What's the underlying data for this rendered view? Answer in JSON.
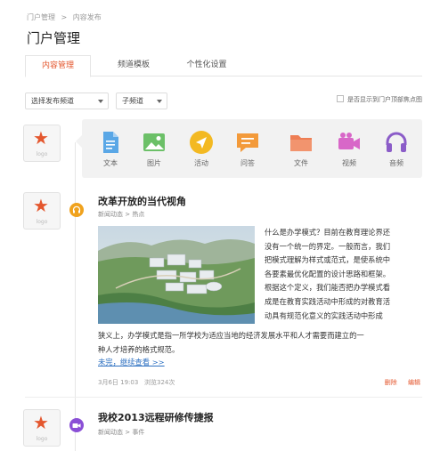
{
  "breadcrumb": {
    "item1": "门户管理",
    "separator": ">",
    "item2": "内容发布"
  },
  "page_title": "门户管理",
  "tabs": [
    {
      "label": "内容管理",
      "active": true
    },
    {
      "label": "频道模板",
      "active": false
    },
    {
      "label": "个性化设置",
      "active": false
    }
  ],
  "filters": {
    "channel_select": "选择发布频道",
    "subchannel_select": "子频道",
    "checkbox_label": "是否显示到门户顶部焦点图",
    "checkbox_checked": false
  },
  "logo_text": "logo",
  "compose_types": [
    {
      "label": "文本",
      "icon": "document-icon",
      "color": "#5aa7e6"
    },
    {
      "label": "图片",
      "icon": "image-icon",
      "color": "#6cc068"
    },
    {
      "label": "活动",
      "icon": "location-arrow-icon",
      "color": "#f3b922"
    },
    {
      "label": "问答",
      "icon": "chat-icon",
      "color": "#f39a3a"
    },
    {
      "label": "文件",
      "icon": "folder-icon",
      "color": "#ee7e54"
    },
    {
      "label": "视频",
      "icon": "video-icon",
      "color": "#d867c8"
    },
    {
      "label": "音频",
      "icon": "headphones-icon",
      "color": "#8b5cc8"
    }
  ],
  "posts": [
    {
      "title": "改革开放的当代视角",
      "category": "新闻动态 > 热点",
      "type_icon": "headphones-icon",
      "type_color": "#f0a21d",
      "text_lines": [
        "什么是办学模式？目前在教育理论界还",
        "没有一个统一的界定。一般而言，我们",
        "把模式理解为样式或范式，是使系统中",
        "各要素最优化配置的设计思路和框架。",
        "根据这个定义，我们能否把办学模式看",
        "成是在教育实践活动中形成的对教育活",
        "动具有规范化意义的实践活动中形成"
      ],
      "text_full_lines": [
        "狭义上，办学模式是指一所学校为适应当地的经济发展水平和人才需要而建立的一",
        "种人才培养的格式规范。"
      ],
      "read_more": "未完，继续查看 >>",
      "date": "3月6日 19:03",
      "views": "浏览324次",
      "actions": {
        "delete": "删除",
        "edit": "编辑"
      }
    },
    {
      "title": "我校2013远程研修传捷报",
      "category": "新闻动态 > 事件",
      "type_icon": "video-icon",
      "type_color": "#8a4fd6"
    }
  ]
}
